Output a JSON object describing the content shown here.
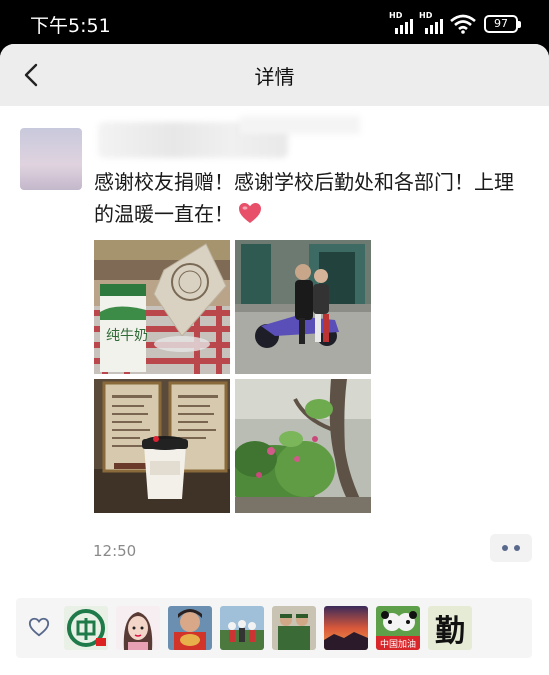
{
  "status_bar": {
    "time": "下午5:51",
    "network_labels": [
      "HD",
      "HD"
    ],
    "battery": "97"
  },
  "nav": {
    "title": "详情",
    "back_icon": "chevron-left-icon"
  },
  "post": {
    "text": "感谢校友捐赠！感谢学校后勤处和各部门！上理的温暖一直在！",
    "emoji": "heart",
    "photos": [
      {
        "name": "photo-milk-carton",
        "carton_text": "纯牛奶"
      },
      {
        "name": "photo-scooter-riders"
      },
      {
        "name": "photo-menu-and-coffee-cup"
      },
      {
        "name": "photo-plants-and-tree"
      }
    ],
    "time": "12:50"
  },
  "likes": {
    "icon": "heart-outline-icon",
    "last_avatar_char": "勤",
    "avatars": [
      "avatar-green-logo",
      "avatar-cartoon-girl",
      "avatar-person-food",
      "avatar-group-photo",
      "avatar-soldiers",
      "avatar-sunset",
      "avatar-panda-china",
      "avatar-calligraphy"
    ],
    "panda_caption": "中国加油"
  },
  "colors": {
    "background": "#ededed",
    "link_blue": "#59698c",
    "heart_red": "#e8506a"
  }
}
